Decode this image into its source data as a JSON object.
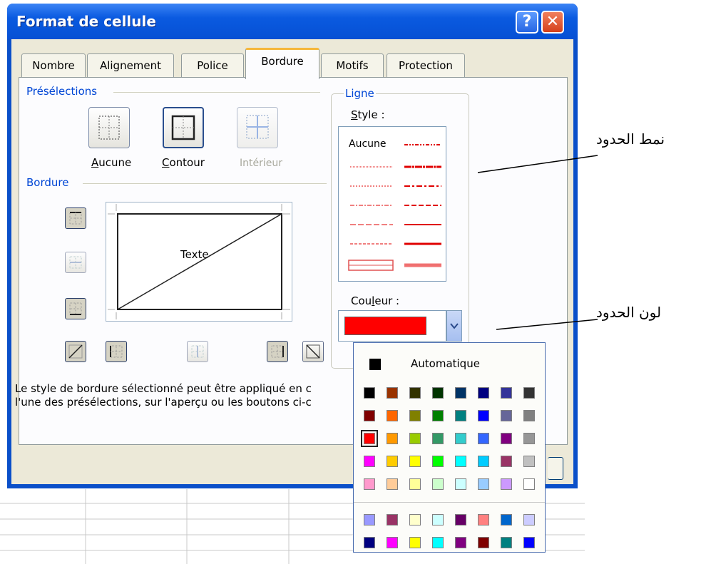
{
  "dialog": {
    "title": "Format de cellule",
    "help_glyph": "?",
    "close_glyph": "✕"
  },
  "tabs": [
    {
      "label": "Nombre"
    },
    {
      "label": "Alignement"
    },
    {
      "label": "Police"
    },
    {
      "label": "Bordure",
      "active": true
    },
    {
      "label": "Motifs"
    },
    {
      "label": "Protection"
    }
  ],
  "presets": {
    "title": "Présélections",
    "aucune_u": "A",
    "aucune_rest": "ucune",
    "contour_u": "C",
    "contour_rest": "ontour",
    "interieur": "Intérieur"
  },
  "border": {
    "title": "Bordure",
    "preview_text": "Texte"
  },
  "line": {
    "title": "Ligne",
    "style_u": "S",
    "style_rest": "tyle :",
    "none_label": "Aucune",
    "color_pre": "Cou",
    "color_u": "l",
    "color_rest": "eur :",
    "selected_color": "#ff0000"
  },
  "description": {
    "line1": "Le style de bordure sélectionné peut être appliqué en c",
    "line2": "l'une des présélections, sur l'aperçu ou les boutons ci-c"
  },
  "palette": {
    "automatic_label": "Automatique",
    "automatic_color": "#000000",
    "rows": [
      [
        "#000000",
        "#993300",
        "#333300",
        "#003300",
        "#003366",
        "#000080",
        "#333399",
        "#333333"
      ],
      [
        "#800000",
        "#ff6600",
        "#808000",
        "#008000",
        "#008080",
        "#0000ff",
        "#666699",
        "#808080"
      ],
      [
        "#ff0000",
        "#ff9900",
        "#99cc00",
        "#339966",
        "#33cccc",
        "#3366ff",
        "#800080",
        "#969696"
      ],
      [
        "#ff00ff",
        "#ffcc00",
        "#ffff00",
        "#00ff00",
        "#00ffff",
        "#00ccff",
        "#993366",
        "#c0c0c0"
      ],
      [
        "#ff99cc",
        "#ffcc99",
        "#ffff99",
        "#ccffcc",
        "#ccffff",
        "#99ccff",
        "#cc99ff",
        "#ffffff"
      ]
    ],
    "extra_rows": [
      [
        "#9999ff",
        "#993366",
        "#ffffcc",
        "#ccffff",
        "#660066",
        "#ff8080",
        "#0066cc",
        "#ccccff"
      ],
      [
        "#000080",
        "#ff00ff",
        "#ffff00",
        "#00ffff",
        "#800080",
        "#800000",
        "#008080",
        "#0000ff"
      ]
    ],
    "selected": "#ff0000"
  },
  "annotations": {
    "style_note": "نمط الحدود",
    "color_note": "لون الحدود"
  }
}
